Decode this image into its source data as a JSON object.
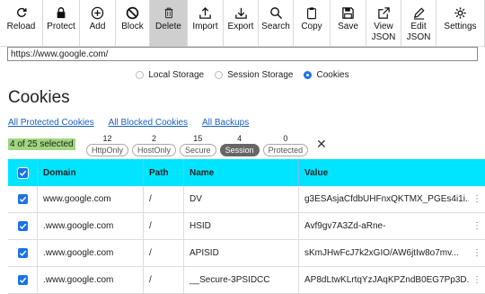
{
  "toolbar": [
    {
      "name": "reload-button",
      "icon": "reload-icon",
      "label": "Reload",
      "w": 48
    },
    {
      "name": "protect-button",
      "icon": "lock-icon",
      "label": "Protect",
      "w": 41
    },
    {
      "name": "add-button",
      "icon": "plus-circle-icon",
      "label": "Add",
      "w": 40
    },
    {
      "name": "block-button",
      "icon": "block-icon",
      "label": "Block",
      "w": 38
    },
    {
      "name": "delete-button",
      "icon": "trash-icon",
      "label": "Delete",
      "w": 42,
      "active": true
    },
    {
      "name": "import-button",
      "icon": "upload-icon",
      "label": "Import",
      "w": 40
    },
    {
      "name": "export-button",
      "icon": "download-icon",
      "label": "Export",
      "w": 39
    },
    {
      "name": "search-button",
      "icon": "search-icon",
      "label": "Search",
      "w": 39
    },
    {
      "name": "copy-button",
      "icon": "clipboard-icon",
      "label": "Copy",
      "w": 41
    },
    {
      "name": "save-button",
      "icon": "save-icon",
      "label": "Save",
      "w": 40
    },
    {
      "name": "view-json-button",
      "icon": "external-link-icon",
      "label": "View\nJSON",
      "w": 39
    },
    {
      "name": "edit-json-button",
      "icon": "edit-icon",
      "label": "Edit\nJSON",
      "w": 39
    },
    {
      "name": "settings-button",
      "icon": "gear-icon",
      "label": "Settings",
      "w": 54
    }
  ],
  "url": "https://www.google.com/",
  "storage": {
    "local": "Local Storage",
    "session": "Session Storage",
    "cookies": "Cookies",
    "selected": "cookies"
  },
  "title": "Cookies",
  "links": {
    "protected": "All Protected Cookies",
    "blocked": "All Blocked Cookies",
    "backups": "All Backups"
  },
  "selection": "4 of 25 selected",
  "filters": [
    {
      "count": "12",
      "label": "HttpOnly",
      "active": false
    },
    {
      "count": "2",
      "label": "HostOnly",
      "active": false
    },
    {
      "count": "15",
      "label": "Secure",
      "active": false
    },
    {
      "count": "4",
      "label": "Session",
      "active": true
    },
    {
      "count": "0",
      "label": "Protected",
      "active": false
    }
  ],
  "table": {
    "headers": {
      "domain": "Domain",
      "path": "Path",
      "name": "Name",
      "value": "Value"
    },
    "rows": [
      {
        "domain": "www.google.com",
        "path": "/",
        "name": "DV",
        "value": "g3ESAsjaCfdbUHFnxQKTMX_PGEs4i1i..."
      },
      {
        "domain": ".www.google.com",
        "path": "/",
        "name": "HSID",
        "value": "Avf9gv7A3Zd-aRne-"
      },
      {
        "domain": ".www.google.com",
        "path": "/",
        "name": "APISID",
        "value": "sKmJHwFcJ7k2xGIO/AW6jtIw8o7mv..."
      },
      {
        "domain": ".www.google.com",
        "path": "/",
        "name": "__Secure-3PSIDCC",
        "value": "AP8dLtwKLrtqYzJAqKPZndB0EG7Pp3D..."
      }
    ]
  },
  "colors": {
    "accent": "#1a73e8",
    "header": "#00e5ff",
    "selection": "#9fd67f"
  }
}
